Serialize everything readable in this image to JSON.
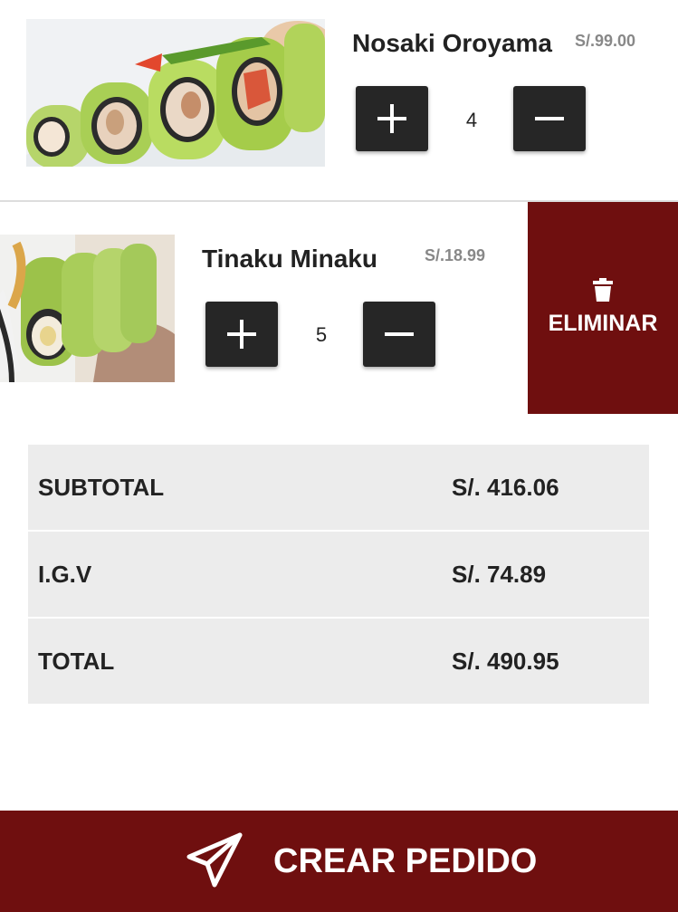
{
  "cart": {
    "items": [
      {
        "name": "Nosaki Oroyama",
        "price": "S/.99.00",
        "quantity": "4",
        "image": "sushi-roll-avocado-photo"
      },
      {
        "name": "Tinaku Minaku",
        "price": "S/.18.99",
        "quantity": "5",
        "image": "sushi-roll-tempura-photo"
      }
    ],
    "delete_action": {
      "label": "ELIMINAR",
      "icon": "trash-icon"
    }
  },
  "summary": {
    "rows": [
      {
        "label": "SUBTOTAL",
        "value": "S/. 416.06"
      },
      {
        "label": "I.G.V",
        "value": "S/. 74.89"
      },
      {
        "label": "TOTAL",
        "value": "S/. 490.95"
      }
    ]
  },
  "footer": {
    "button_label": "CREAR PEDIDO",
    "icon": "send-icon"
  },
  "colors": {
    "accent": "#6f0f0f",
    "button_dark": "#262626",
    "summary_bg": "#ececec",
    "muted_text": "#888888"
  }
}
